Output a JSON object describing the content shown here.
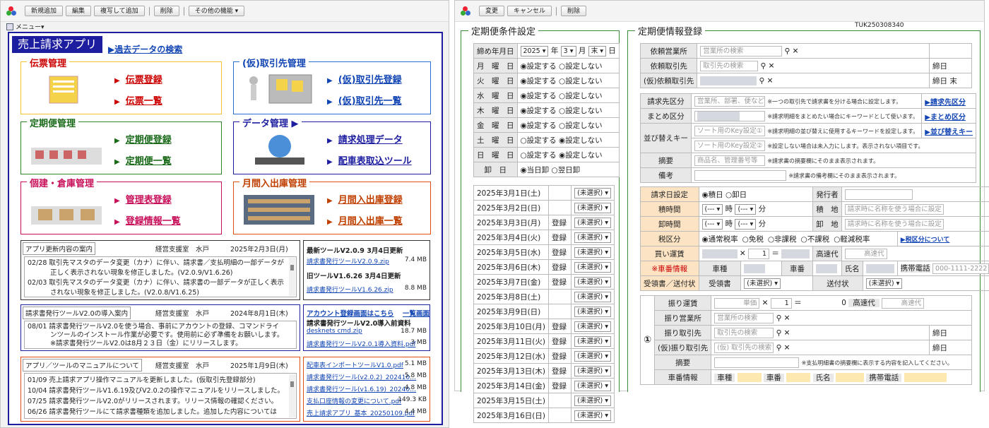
{
  "w1": {
    "toolbar": [
      "新規追加",
      "編集",
      "複写して追加",
      "削除",
      "その他の機能 ▾"
    ],
    "menu": "メニュー▾",
    "app_title": "売上請求アプリ",
    "search_past": "▶過去データの検索",
    "tiles": [
      {
        "title": "伝票管理",
        "links": [
          "伝票登録",
          "伝票一覧"
        ]
      },
      {
        "title": "(仮)取引先管理",
        "links": [
          "(仮)取引先登録",
          "(仮)取引先一覧"
        ]
      },
      {
        "title": "定期便管理",
        "links": [
          "定期便登録",
          "定期便一覧"
        ]
      },
      {
        "title": "データ管理 ▶",
        "links": [
          "請求処理データ",
          "配車表取込ツール"
        ]
      },
      {
        "title": "個建・倉庫管理",
        "links": [
          "管理表登録",
          "登録情報一覧"
        ]
      },
      {
        "title": "月間入出庫管理",
        "links": [
          "月間入出庫登録",
          "月間入出庫一覧"
        ]
      }
    ],
    "news": [
      {
        "header": "アプリ更新内容の案内",
        "dept": "経営支援室　水戸",
        "date": "2025年2月3日(月)",
        "rows": [
          "02/28 取引先マスタのデータ変更（カナ）に伴い、請求書／支払明細の一部データが",
          "正しく表示されない現象を修正しました。(V2.0.9/V1.6.26)",
          "02/03 取引先マスタのデータ変更（カナ）に伴い、請求書の一部データが正しく表示",
          "されない現象を修正しました。(V2.0.8/V1.6.25)"
        ]
      },
      {
        "header": "請求書発行ツールV2.0の導入案内",
        "dept": "経営支援室　水戸",
        "date": "2024年8月1日(木)",
        "rows": [
          "08/01 請求書発行ツールV2.0を使う場合、事前にアカウントの登録、コマンドライ",
          "ンツールのインストール作業が必要です。使用前に必ず準備をお願いします。",
          "※請求書発行ツールV2.0は8月２３日（金）にリリースします。"
        ]
      },
      {
        "header": "アプリ／ツールのマニュアルについて",
        "dept": "経営支援室　水戸",
        "date": "2025年1月9日(木)",
        "rows": [
          "01/09 売上請求アプリ操作マニュアルを更新しました。(仮取引先登録部分)",
          "10/04 請求書発行ツールV1.6.19及びV2.0.2の操作マニュアルをリリースしました。",
          "07/25 請求書発行ツールV2.0がリリースされます。リリース情報の確認ください。",
          "06/26 請求書発行ツールにて請求書種類を追加しました。追加した内容については"
        ]
      }
    ],
    "dl1": {
      "new_title": "最新ツールV2.0.9 3月4日更新",
      "new_file": "請求書発行ツールV2.0.9.zip",
      "new_size": "7.4 MB",
      "old_title": "旧ツールV1.6.26 3月4日更新",
      "old_file": "請求書発行ツールV1.6.26.zip",
      "old_size": "8.8 MB"
    },
    "dl2": {
      "link1": "アカウント登録画面はこちら",
      "link2": "一覧画面",
      "title": "請求書発行ツールV2.0導入前資料",
      "files": [
        [
          "desknets cmd.zip",
          "18.7 MB"
        ],
        [
          "請求書発行ツールV2.0.1導入資料.pdf",
          "3 MB"
        ]
      ]
    },
    "dl3": {
      "files": [
        [
          "配車表インポートツールV1.0.pdf",
          "5.1 MB"
        ],
        [
          "請求書発行ツール(v2.0.2)_202410…",
          "5.8 MB"
        ],
        [
          "請求書発行ツール(v1.6.19)_20240…",
          "4.8 MB"
        ],
        [
          "支払口座情報の変更について.pdf",
          "149.3 KB"
        ],
        [
          "売上請求アプリ_基本_20250109.pdf",
          "4.4 MB"
        ]
      ]
    }
  },
  "w2": {
    "toolbar": [
      "変更",
      "キャンセル",
      "削除"
    ],
    "record_id": "TUK250308340",
    "cond": {
      "legend": "定期便条件設定",
      "ym_label": "締め年月日",
      "year": "2025",
      "year_u": "年",
      "month": "3",
      "month_u": "月",
      "day": "末",
      "day_u": "日",
      "days": [
        [
          "月　曜　日",
          "1"
        ],
        [
          "火　曜　日",
          "1"
        ],
        [
          "水　曜　日",
          "1"
        ],
        [
          "木　曜　日",
          "1"
        ],
        [
          "金　曜　日",
          "1"
        ],
        [
          "土　曜　日",
          "0"
        ],
        [
          "日　曜　日",
          "0"
        ]
      ],
      "opt_on": "設定する",
      "opt_off": "設定しない",
      "unload_label": "卸　日",
      "unload1": "当日卸",
      "unload2": "翌日卸",
      "dates": [
        [
          "2025年3月1日(土)",
          ""
        ],
        [
          "2025年3月2日(日)",
          ""
        ],
        [
          "2025年3月3日(月)",
          "登録"
        ],
        [
          "2025年3月4日(火)",
          "登録"
        ],
        [
          "2025年3月5日(水)",
          "登録"
        ],
        [
          "2025年3月6日(木)",
          "登録"
        ],
        [
          "2025年3月7日(金)",
          "登録"
        ],
        [
          "2025年3月8日(土)",
          ""
        ],
        [
          "2025年3月9日(日)",
          ""
        ],
        [
          "2025年3月10日(月)",
          "登録"
        ],
        [
          "2025年3月11日(火)",
          "登録"
        ],
        [
          "2025年3月12日(水)",
          "登録"
        ],
        [
          "2025年3月13日(木)",
          "登録"
        ],
        [
          "2025年3月14日(金)",
          "登録"
        ],
        [
          "2025年3月15日(土)",
          ""
        ],
        [
          "2025年3月16日(日)",
          ""
        ]
      ],
      "unselected": "(未選択)"
    },
    "info": {
      "legend": "定期便情報登録",
      "r1": [
        [
          "依頼営業所",
          "営業所の検索",
          ""
        ],
        [
          "依頼取引先",
          "取引先の検索",
          "締日"
        ],
        [
          "(仮)依頼取引先",
          "",
          "締日 末"
        ]
      ],
      "claim_label": "請求先区分",
      "claim_ph": "営業所、部署、便など",
      "claim_note": "※一つの取引先で請求書を分ける場合に設定します。",
      "claim_link": "▶請求先区分",
      "group_label": "まとめ区分",
      "group_note": "※請求明細をまとめたい場合にキーワードとして使います。",
      "group_link": "▶まとめ区分",
      "sort_label": "並び替えキー",
      "sort_ph1": "ソート用のKey設定①",
      "sort_ph2": "ソート用のKey設定②",
      "sort_note1": "※請求明細の並び替えに使用するキーワードを設定します。",
      "sort_note2": "※設定しない場合は未入力にします。表示されない項目です。",
      "sort_link": "▶並び替えキー",
      "sum_label": "摘要",
      "sum_ph": "商品名、管理番号等",
      "sum_note": "※請求書の摘要欄にそのまま表示されます。",
      "rem_label": "備考",
      "rem_note": "※請求書の備考欄にそのまま表示されます。",
      "bill_label": "請求日設定",
      "bill1": "積日",
      "bill2": "卸日",
      "issuer": "発行者",
      "load_label": "積時間",
      "load_loc": "積　地",
      "load_ph": "請求時に名称を使う場合に設定",
      "unl_label": "卸時間",
      "unl_loc": "卸　地",
      "hour_u": "時",
      "min_u": "分",
      "dash": "(--- ▾",
      "tax_label": "税区分",
      "tax_opts": [
        "通常税率",
        "免税",
        "非課税",
        "不課税",
        "軽減税率"
      ],
      "tax_link": "▶税区分について",
      "fare_label": "買い運賃",
      "mul": "✕",
      "qty": "1",
      "eq": "＝",
      "hwy": "高速代",
      "hwy_ph": "高速代",
      "car_label": "※車番情報",
      "car_type": "車種",
      "car_no": "車番",
      "name": "氏名",
      "phone": "携帯電話",
      "phone_ph": "000-1111-2222",
      "recv_label": "受領書／送付状",
      "recv": "受領書",
      "send": "送付状",
      "sec": {
        "num": "①",
        "trans": "振り運賃",
        "unit": "単価",
        "zero": "0",
        "office": "振り営業所",
        "office_ph": "営業所の検索",
        "client": "振り取引先",
        "client_ph": "取引先の検索",
        "tmp": "(仮)振り取引先",
        "tmp_ph": "(仮) 取引先の検索",
        "close": "締日",
        "sum": "摘要",
        "sum_note": "※支払明細書の摘要欄に表示する内容を記入してください。",
        "car": "車番情報"
      }
    }
  }
}
